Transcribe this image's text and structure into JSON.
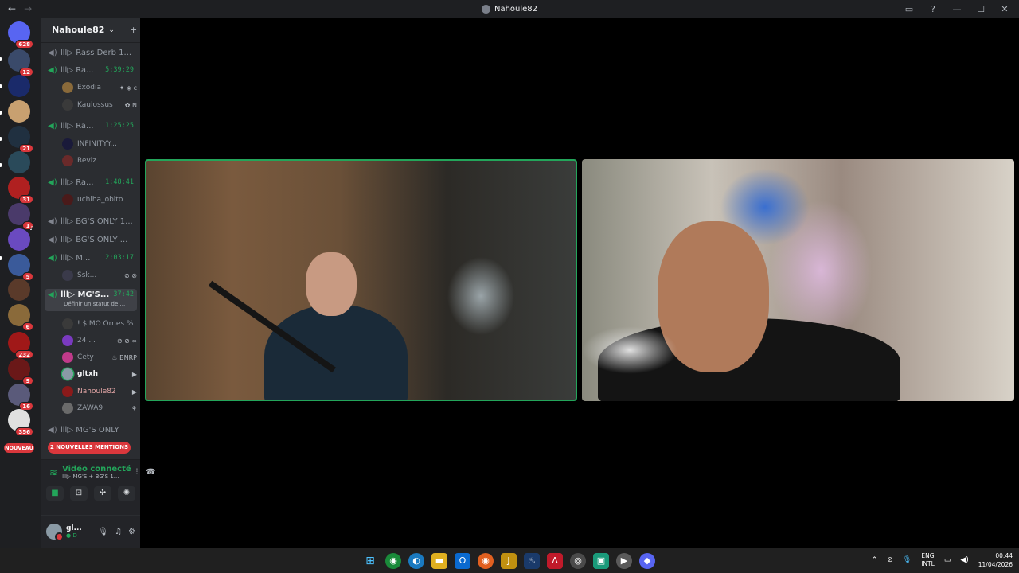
{
  "window": {
    "title": "Nahoule82",
    "nav_back": "←",
    "nav_forward": "→",
    "controls": [
      "▭",
      "?",
      "—",
      "☐",
      "✕"
    ]
  },
  "rail": {
    "servers": [
      {
        "color": "#5865f2",
        "badge": "628",
        "glyph": "◉"
      },
      {
        "color": "#3a4a6a",
        "badge": "12"
      },
      {
        "color": "#1a2a6a",
        "badge": ""
      },
      {
        "color": "#c8a070",
        "badge": ""
      },
      {
        "color": "#203040",
        "badge": "21"
      },
      {
        "color": "#2a4a5a",
        "badge": ""
      },
      {
        "color": "#b02020",
        "badge": "31"
      },
      {
        "color": "#4a3a6a",
        "badge": "1"
      },
      {
        "color": "#6a4ac0",
        "badge": ""
      },
      {
        "color": "#3a5a9a",
        "badge": "5"
      },
      {
        "color": "#5a3a2a",
        "badge": ""
      },
      {
        "color": "#8a6a3a",
        "badge": "6"
      },
      {
        "color": "#a01818",
        "badge": "232"
      },
      {
        "color": "#6a1818",
        "badge": "9"
      },
      {
        "color": "#5a5a7a",
        "badge": "16"
      },
      {
        "color": "#e0e0e0",
        "badge": "356"
      }
    ],
    "nouveau": "NOUVEAU"
  },
  "guild": {
    "name": "Nahoule82",
    "chevron": "⌄",
    "invite_icon": "+"
  },
  "channels": [
    {
      "name": "lll▷ Rass Derb 1...",
      "timer": "",
      "active": false,
      "muted": true
    },
    {
      "name": "lll▷ Ra...",
      "timer": "5:39:29",
      "active": false,
      "muted": false
    },
    {
      "name": "lll▷ Ra...",
      "timer": "1:25:25",
      "active": false,
      "muted": false
    },
    {
      "name": "lll▷ Ra...",
      "timer": "1:48:41",
      "active": false,
      "muted": false
    },
    {
      "name": "lll▷ BG'S ONLY 1...",
      "timer": "",
      "active": false,
      "muted": true
    },
    {
      "name": "lll▷ BG'S ONLY ...",
      "timer": "",
      "active": false,
      "muted": true
    },
    {
      "name": "lll▷ M...",
      "timer": "2:03:17",
      "active": false,
      "muted": false
    },
    {
      "name": "lll▷ MG'S...",
      "timer": "37:42",
      "active": true,
      "muted": false,
      "sub": "Définir un statut de ..."
    },
    {
      "name": "lll▷ MG'S ONLY",
      "timer": "",
      "active": false,
      "muted": true
    }
  ],
  "users": [
    {
      "name": "Exodia",
      "icons": "✦ ◈ c",
      "color": "#8a6a3a"
    },
    {
      "name": "Kaulossus",
      "icons": "✿ N",
      "color": "#3a3a3a"
    },
    {
      "name": "INFINITYY...",
      "icons": "",
      "color": "#1a1a3a"
    },
    {
      "name": "Reviz",
      "icons": "",
      "color": "#6a2a2a"
    },
    {
      "name": "uchiha_obito",
      "icons": "",
      "color": "#4a1a1a"
    },
    {
      "name": "Ssk...",
      "icons": "⊘ ⊘",
      "color": "#3a3a4a",
      "prefix": "❦"
    },
    {
      "name": "! $IMO Ornes %",
      "icons": "",
      "color": "#3a3a3a"
    },
    {
      "name": "24 ...",
      "icons": "⊘ ⊘ ∞",
      "color": "#7a3ac0"
    },
    {
      "name": "Cety",
      "icons": "♨ BNRP",
      "color": "#c03a8a"
    },
    {
      "name": "gltxh",
      "icons": "▶",
      "color": "#8a9aa5",
      "bright": true
    },
    {
      "name": "Nahoule82",
      "icons": "▶",
      "color": "#8a1a1a"
    },
    {
      "name": "ZAWA9",
      "icons": "⚘",
      "color": "#6a6a6a"
    }
  ],
  "mentions_label": "2 NOUVELLES MENTIONS",
  "voice": {
    "status": "Vidéo connecté",
    "channel": "lll▷ MG'S + BG'S 1...",
    "buttons": [
      "■",
      "⊡",
      "✣",
      "✺"
    ]
  },
  "me": {
    "name": "gl...",
    "status": "● D"
  },
  "taskbar": {
    "apps": [
      {
        "glyph": "⊞",
        "color": "#0a74da"
      },
      {
        "glyph": "◉",
        "color": "#1a8a3a"
      },
      {
        "glyph": "◐",
        "color": "#1a7ac0"
      },
      {
        "glyph": "▬",
        "color": "#e0b020"
      },
      {
        "glyph": "O",
        "color": "#0a6ad0"
      },
      {
        "glyph": "◉",
        "color": "#e06020"
      },
      {
        "glyph": "J",
        "color": "#c09010"
      },
      {
        "glyph": "♨",
        "color": "#1a3a6a"
      },
      {
        "glyph": "Λ",
        "color": "#c01a2a"
      },
      {
        "glyph": "◎",
        "color": "#4a4a4a"
      },
      {
        "glyph": "▣",
        "color": "#1a9a7a"
      },
      {
        "glyph": "▶",
        "color": "#5a5a5a"
      },
      {
        "glyph": "◆",
        "color": "#5865f2"
      }
    ],
    "lang_top": "ENG",
    "lang_bottom": "INTL",
    "time": "00:44",
    "date": "11/04/2026"
  }
}
